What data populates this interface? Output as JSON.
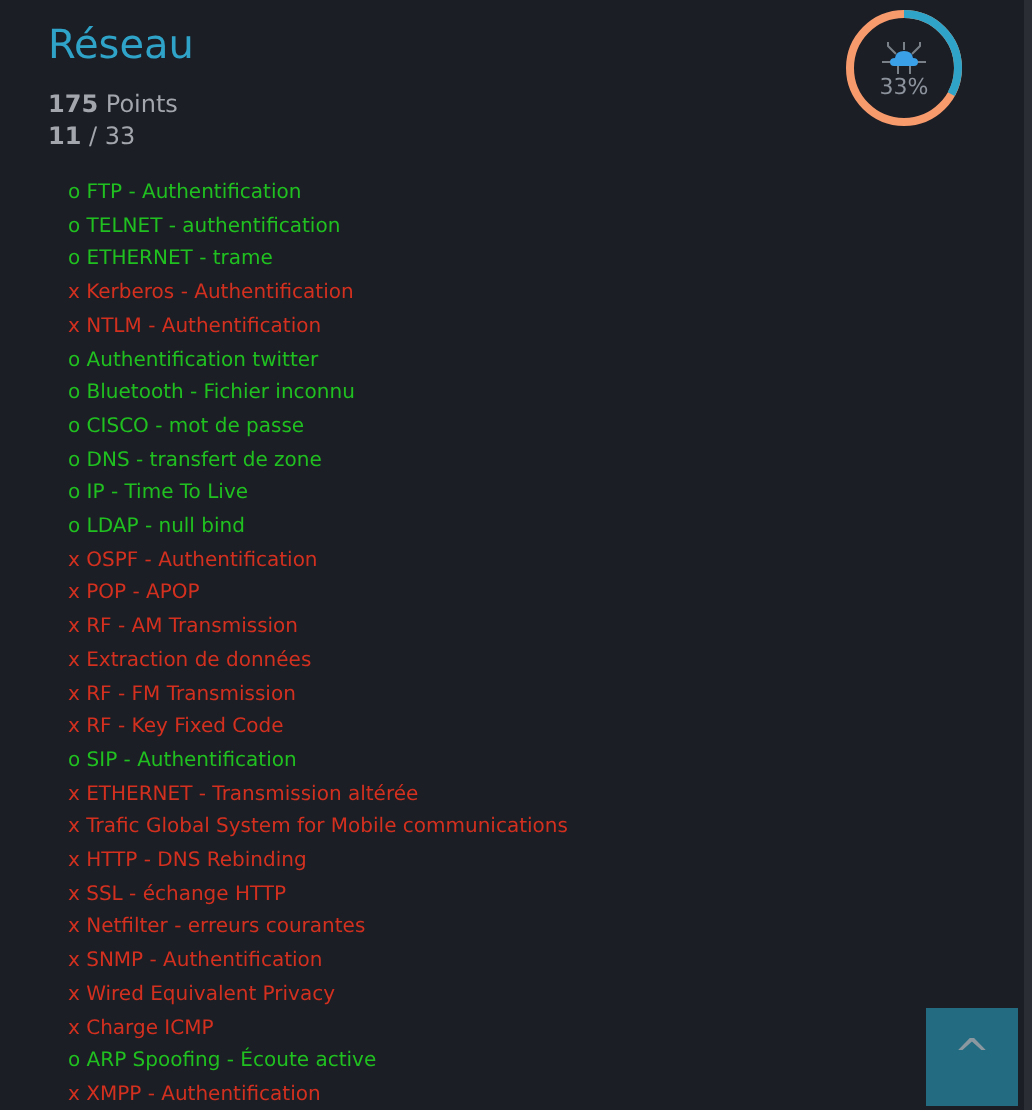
{
  "title": "Réseau",
  "points": {
    "value": "175",
    "unit": "Points"
  },
  "progress": {
    "done": "11",
    "sep": "/",
    "total": "33"
  },
  "ring": {
    "label": "33%"
  },
  "challenges": [
    {
      "text": "o FTP - Authentification",
      "solved": true
    },
    {
      "text": "o TELNET - authentification",
      "solved": true
    },
    {
      "text": "o ETHERNET - trame",
      "solved": true
    },
    {
      "text": "x Kerberos - Authentification",
      "solved": false
    },
    {
      "text": "x NTLM - Authentification",
      "solved": false
    },
    {
      "text": "o Authentification twitter",
      "solved": true
    },
    {
      "text": "o Bluetooth - Fichier inconnu",
      "solved": true
    },
    {
      "text": "o CISCO - mot de passe",
      "solved": true
    },
    {
      "text": "o DNS - transfert de zone",
      "solved": true
    },
    {
      "text": "o IP - Time To Live",
      "solved": true
    },
    {
      "text": "o LDAP - null bind",
      "solved": true
    },
    {
      "text": "x OSPF - Authentification",
      "solved": false
    },
    {
      "text": "x POP - APOP",
      "solved": false
    },
    {
      "text": "x RF - AM Transmission",
      "solved": false
    },
    {
      "text": "x Extraction de données",
      "solved": false
    },
    {
      "text": "x RF - FM Transmission",
      "solved": false
    },
    {
      "text": "x RF - Key Fixed Code",
      "solved": false
    },
    {
      "text": "o SIP - Authentification",
      "solved": true
    },
    {
      "text": "x ETHERNET - Transmission altérée",
      "solved": false
    },
    {
      "text": "x Trafic Global System for Mobile communications",
      "solved": false
    },
    {
      "text": "x HTTP - DNS Rebinding",
      "solved": false
    },
    {
      "text": "x SSL - échange HTTP",
      "solved": false
    },
    {
      "text": "x Netfilter - erreurs courantes",
      "solved": false
    },
    {
      "text": "x SNMP - Authentification",
      "solved": false
    },
    {
      "text": "x Wired Equivalent Privacy",
      "solved": false
    },
    {
      "text": "x Charge ICMP",
      "solved": false
    },
    {
      "text": "o ARP Spoofing - Écoute active",
      "solved": true
    },
    {
      "text": "x XMPP - Authentification",
      "solved": false
    }
  ],
  "scroll_top_button": {
    "label": "^"
  }
}
